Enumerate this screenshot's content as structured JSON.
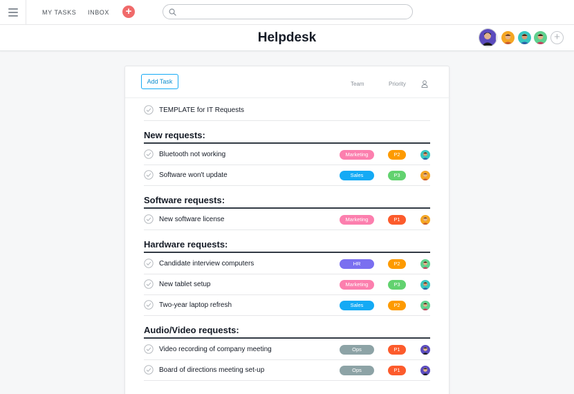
{
  "nav": {
    "my_tasks": "MY TASKS",
    "inbox": "INBOX",
    "search_value": "",
    "search_placeholder": ""
  },
  "project": {
    "title": "Helpdesk"
  },
  "toolbar": {
    "add_task_label": "Add Task",
    "team_header": "Team",
    "priority_header": "Priority"
  },
  "colors": {
    "accent": "#14aaf5",
    "add_button": "#f06a6a",
    "Marketing": "#fc7fae",
    "Sales": "#14aaf5",
    "HR": "#7a6ff0",
    "Ops": "#8da3a6",
    "P1": "#fc5b2c",
    "P2": "#fd9a00",
    "P3": "#62d26f"
  },
  "template_task": {
    "name": "TEMPLATE for IT Requests"
  },
  "sections": [
    {
      "title": "New requests:",
      "tasks": [
        {
          "name": "Bluetooth not working",
          "team": "Marketing",
          "priority": "P2",
          "assignee_icon": "avatar-teal-icon"
        },
        {
          "name": "Software won't update",
          "team": "Sales",
          "priority": "P3",
          "assignee_icon": "avatar-orange-icon"
        }
      ]
    },
    {
      "title": "Software requests:",
      "tasks": [
        {
          "name": "New software license",
          "team": "Marketing",
          "priority": "P1",
          "assignee_icon": "avatar-orange-icon"
        }
      ]
    },
    {
      "title": "Hardware requests:",
      "tasks": [
        {
          "name": "Candidate interview computers",
          "team": "HR",
          "priority": "P2",
          "assignee_icon": "avatar-green-icon"
        },
        {
          "name": "New tablet setup",
          "team": "Marketing",
          "priority": "P3",
          "assignee_icon": "avatar-teal-icon"
        },
        {
          "name": "Two-year laptop refresh",
          "team": "Sales",
          "priority": "P2",
          "assignee_icon": "avatar-green-icon"
        }
      ]
    },
    {
      "title": "Audio/Video requests:",
      "tasks": [
        {
          "name": "Video recording of company meeting",
          "team": "Ops",
          "priority": "P1",
          "assignee_icon": "avatar-purple-icon"
        },
        {
          "name": "Board of directions meeting set-up",
          "team": "Ops",
          "priority": "P1",
          "assignee_icon": "avatar-purple-icon"
        }
      ]
    }
  ]
}
